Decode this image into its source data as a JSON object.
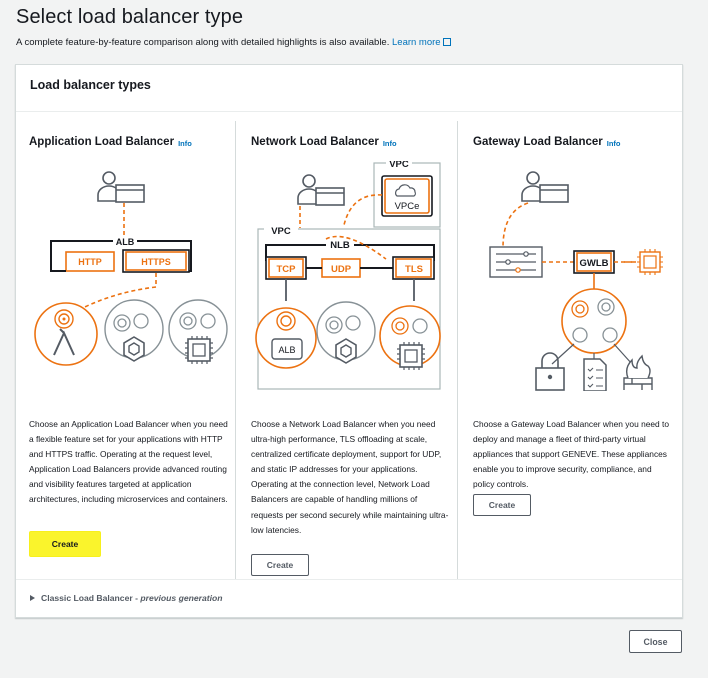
{
  "page": {
    "title": "Select load balancer type",
    "subtitle": "A complete feature-by-feature comparison along with detailed highlights is also available.",
    "learn_more": "Learn more"
  },
  "container": {
    "header": "Load balancer types"
  },
  "cards": [
    {
      "title": "Application Load Balancer",
      "info": "Info",
      "description": "Choose an Application Load Balancer when you need a flexible feature set for your applications with HTTP and HTTPS traffic. Operating at the request level, Application Load Balancers provide advanced routing and visibility features targeted at application architectures, including microservices and containers.",
      "create_label": "Create",
      "diagram": {
        "alb": "ALB",
        "http": "HTTP",
        "https": "HTTPS"
      }
    },
    {
      "title": "Network Load Balancer",
      "info": "Info",
      "description": "Choose a Network Load Balancer when you need ultra-high performance, TLS offloading at scale, centralized certificate deployment, support for UDP, and static IP addresses for your applications. Operating at the connection level, Network Load Balancers are capable of handling millions of requests per second securely while maintaining ultra-low latencies.",
      "create_label": "Create",
      "diagram": {
        "vpc_top": "VPC",
        "vpce": "VPCe",
        "vpc": "VPC",
        "nlb": "NLB",
        "tcp": "TCP",
        "udp": "UDP",
        "tls": "TLS",
        "alb": "ALB"
      }
    },
    {
      "title": "Gateway Load Balancer",
      "info": "Info",
      "description": "Choose a Gateway Load Balancer when you need to deploy and manage a fleet of third-party virtual appliances that support GENEVE. These appliances enable you to improve security, compliance, and policy controls.",
      "create_label": "Create",
      "diagram": {
        "gwlb": "GWLB"
      }
    }
  ],
  "classic": {
    "label": "Classic Load Balancer",
    "separator": " - ",
    "note": "previous generation"
  },
  "footer": {
    "close_label": "Close"
  },
  "colors": {
    "accent_orange": "#ec7211",
    "link_blue": "#0073bb",
    "highlight_yellow": "#faf42c",
    "icon_gray": "#545b64"
  }
}
